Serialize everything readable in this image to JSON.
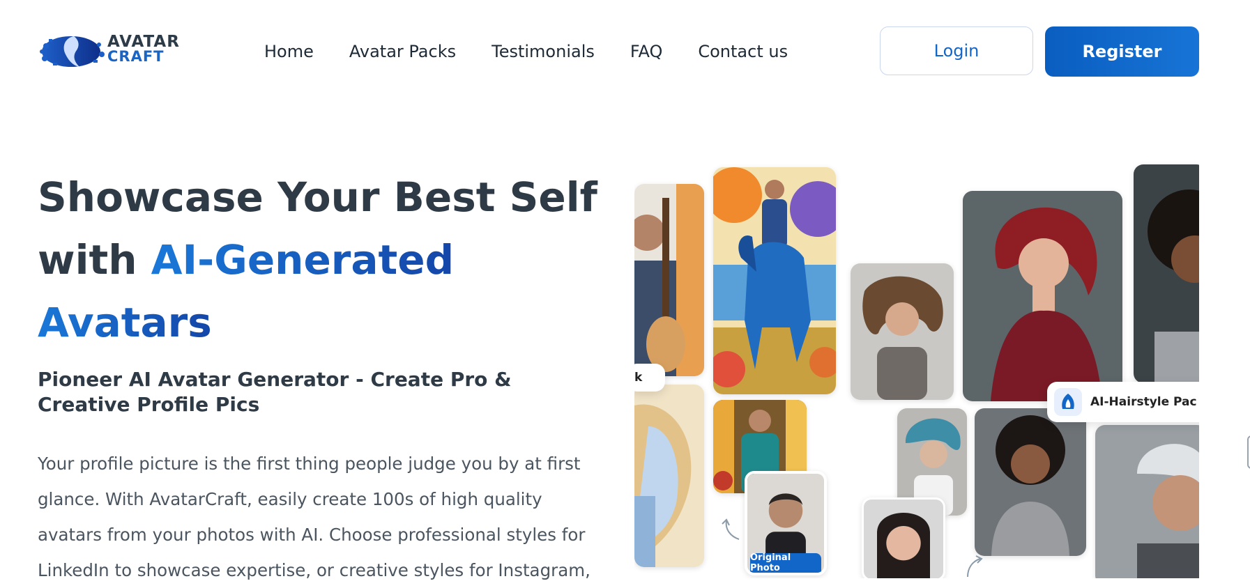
{
  "brand": {
    "logo_line1": "AVATAR",
    "logo_line2": "CRAFT",
    "colors": {
      "primary": "#1266c8",
      "heading": "#2e3b46",
      "text": "#4a5560"
    }
  },
  "nav": {
    "items": [
      {
        "label": "Home"
      },
      {
        "label": "Avatar Packs"
      },
      {
        "label": "Testimonials"
      },
      {
        "label": "FAQ"
      },
      {
        "label": "Contact us"
      }
    ]
  },
  "auth": {
    "login_label": "Login",
    "register_label": "Register"
  },
  "hero": {
    "title_part1": "Showcase Your Best Self",
    "title_with": "with ",
    "title_accent1": "AI-Generated",
    "title_accent2": "Avatars",
    "subtitle": "Pioneer AI Avatar Generator - Create Pro & Creative Profile Pics",
    "description": "Your profile picture is the first thing people judge you by at first glance. With AvatarCraft, easily create 100s of high quality avatars from your photos with AI. Choose professional styles for LinkedIn to showcase expertise, or creative styles for Instagram,"
  },
  "collage": {
    "tag_left": "k",
    "tag_hairstyle": "AI-Hairstyle Pac",
    "original_badge": "Original Photo"
  }
}
